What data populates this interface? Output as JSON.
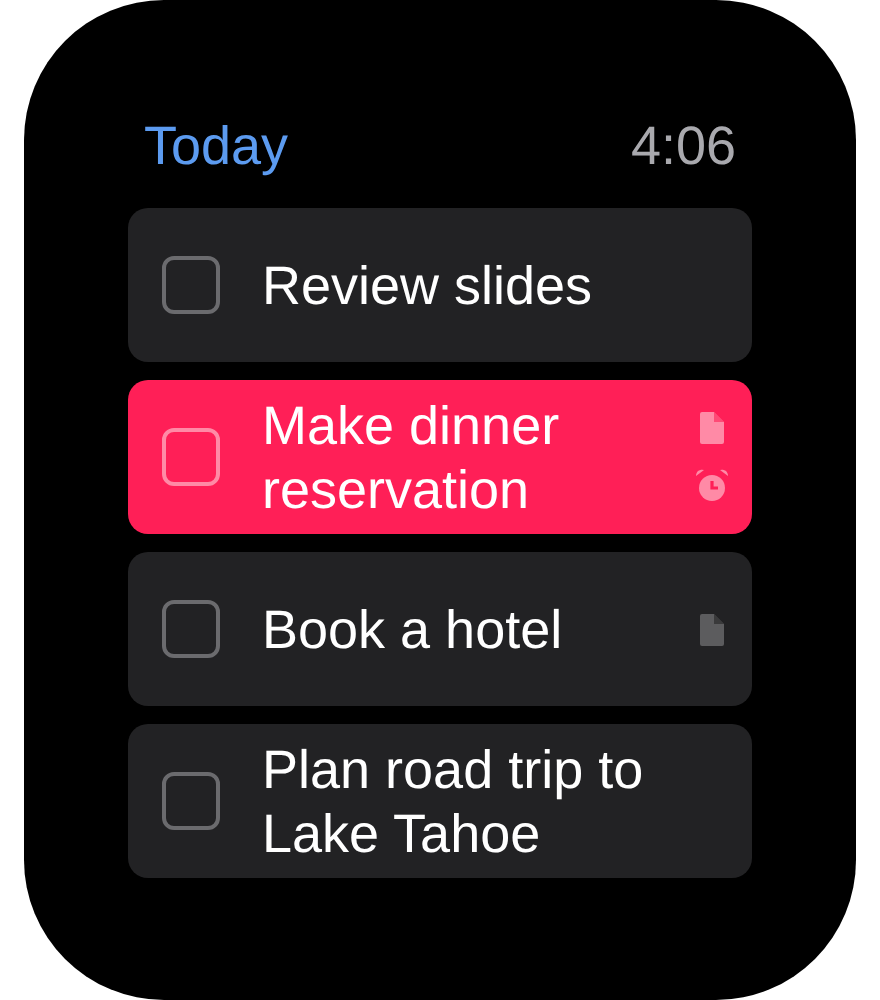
{
  "header": {
    "title": "Today",
    "time": "4:06"
  },
  "tasks": [
    {
      "title": "Review slides",
      "checked": false,
      "selected": false,
      "note": false,
      "alarm": false
    },
    {
      "title": "Make dinner reservation",
      "checked": false,
      "selected": true,
      "note": true,
      "alarm": true
    },
    {
      "title": "Book a hotel",
      "checked": false,
      "selected": false,
      "note": true,
      "alarm": false
    },
    {
      "title": "Plan road trip to Lake Tahoe",
      "checked": false,
      "selected": false,
      "note": false,
      "alarm": false
    }
  ]
}
